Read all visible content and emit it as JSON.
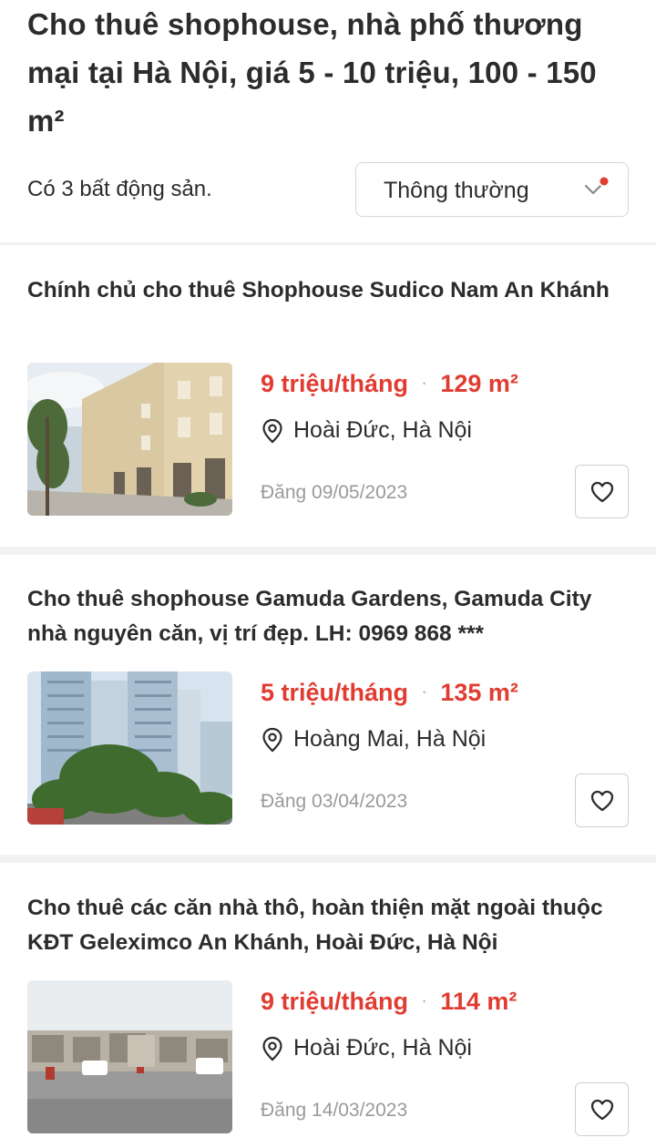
{
  "header": {
    "title": "Cho thuê shophouse, nhà phố thương mại tại Hà Nội, giá 5 - 10 triệu, 100 - 150 m²",
    "result_count": "Có 3 bất động sản.",
    "sort": {
      "selected": "Thông thường"
    }
  },
  "listings": [
    {
      "title": "Chính chủ cho thuê Shophouse Sudico Nam An Khánh",
      "price": "9 triệu/tháng",
      "separator": "·",
      "area": "129 m²",
      "location": "Hoài Đức, Hà Nội",
      "posted": "Đăng 09/05/2023",
      "image_icon": "townhouse-photo"
    },
    {
      "title": "Cho thuê shophouse Gamuda Gardens, Gamuda City nhà nguyên căn, vị trí đẹp. LH: 0969 868 ***",
      "price": "5 triệu/tháng",
      "separator": "·",
      "area": "135 m²",
      "location": "Hoàng Mai, Hà Nội",
      "posted": "Đăng 03/04/2023",
      "image_icon": "apartment-tower-photo"
    },
    {
      "title": "Cho thuê các căn nhà thô, hoàn thiện mặt ngoài thuộc KĐT Geleximco An Khánh, Hoài Đức, Hà Nội",
      "price": "9 triệu/tháng",
      "separator": "·",
      "area": "114 m²",
      "location": "Hoài Đức, Hà Nội",
      "posted": "Đăng 14/03/2023",
      "image_icon": "street-photo"
    }
  ],
  "colors": {
    "accent_red": "#e03c31",
    "text_primary": "#2c2c2c",
    "text_muted": "#9a9a9a",
    "divider": "#f2f2f2",
    "border": "#cfcfcf"
  }
}
